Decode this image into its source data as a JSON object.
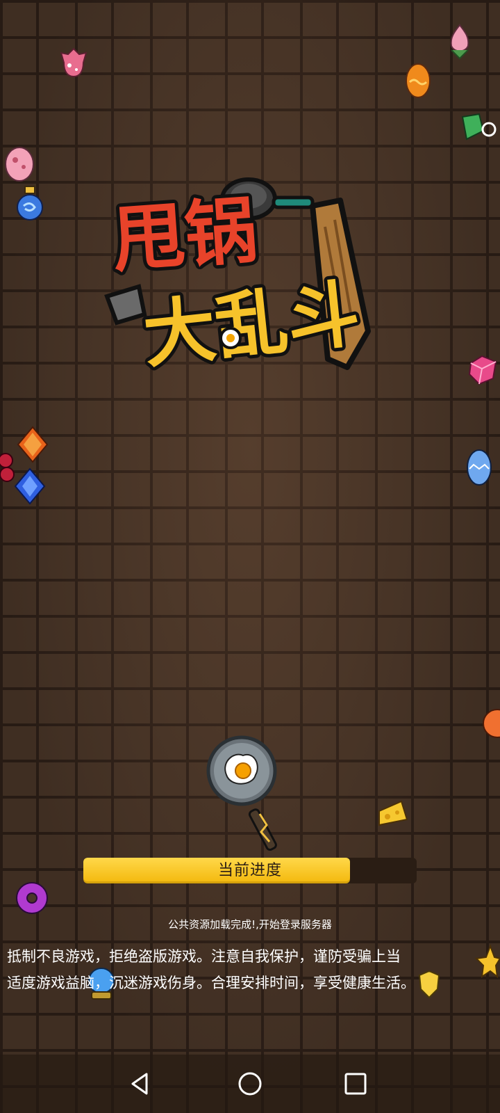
{
  "game": {
    "logo_line1": "甩锅",
    "logo_line2": "大乱斗"
  },
  "loading": {
    "progress_label": "当前进度",
    "progress_fraction": 0.8,
    "status_text": "公共资源加载完成!,开始登录服务器"
  },
  "notice": {
    "line1": "抵制不良游戏，拒绝盗版游戏。注意自我保护，谨防受骗上当",
    "line2": "适度游戏益脑，沉迷游戏伤身。合理安排时间，享受健康生活。"
  },
  "navbar": {
    "back_icon": "back-triangle-icon",
    "home_icon": "home-circle-icon",
    "recents_icon": "recents-square-icon"
  },
  "colors": {
    "progress_fill": "#f3b80c",
    "progress_track": "#2a1d14",
    "background": "#4a3628",
    "logo_red": "#e8432a",
    "logo_yellow": "#f6c22b"
  }
}
